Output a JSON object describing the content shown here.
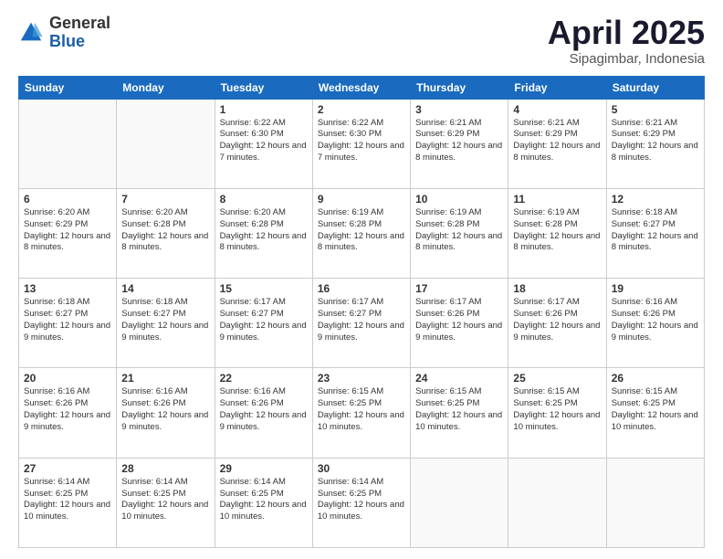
{
  "logo": {
    "general": "General",
    "blue": "Blue"
  },
  "title": "April 2025",
  "subtitle": "Sipagimbar, Indonesia",
  "days": [
    "Sunday",
    "Monday",
    "Tuesday",
    "Wednesday",
    "Thursday",
    "Friday",
    "Saturday"
  ],
  "weeks": [
    [
      {
        "day": "",
        "info": ""
      },
      {
        "day": "",
        "info": ""
      },
      {
        "day": "1",
        "info": "Sunrise: 6:22 AM\nSunset: 6:30 PM\nDaylight: 12 hours and 7 minutes."
      },
      {
        "day": "2",
        "info": "Sunrise: 6:22 AM\nSunset: 6:30 PM\nDaylight: 12 hours and 7 minutes."
      },
      {
        "day": "3",
        "info": "Sunrise: 6:21 AM\nSunset: 6:29 PM\nDaylight: 12 hours and 8 minutes."
      },
      {
        "day": "4",
        "info": "Sunrise: 6:21 AM\nSunset: 6:29 PM\nDaylight: 12 hours and 8 minutes."
      },
      {
        "day": "5",
        "info": "Sunrise: 6:21 AM\nSunset: 6:29 PM\nDaylight: 12 hours and 8 minutes."
      }
    ],
    [
      {
        "day": "6",
        "info": "Sunrise: 6:20 AM\nSunset: 6:29 PM\nDaylight: 12 hours and 8 minutes."
      },
      {
        "day": "7",
        "info": "Sunrise: 6:20 AM\nSunset: 6:28 PM\nDaylight: 12 hours and 8 minutes."
      },
      {
        "day": "8",
        "info": "Sunrise: 6:20 AM\nSunset: 6:28 PM\nDaylight: 12 hours and 8 minutes."
      },
      {
        "day": "9",
        "info": "Sunrise: 6:19 AM\nSunset: 6:28 PM\nDaylight: 12 hours and 8 minutes."
      },
      {
        "day": "10",
        "info": "Sunrise: 6:19 AM\nSunset: 6:28 PM\nDaylight: 12 hours and 8 minutes."
      },
      {
        "day": "11",
        "info": "Sunrise: 6:19 AM\nSunset: 6:28 PM\nDaylight: 12 hours and 8 minutes."
      },
      {
        "day": "12",
        "info": "Sunrise: 6:18 AM\nSunset: 6:27 PM\nDaylight: 12 hours and 8 minutes."
      }
    ],
    [
      {
        "day": "13",
        "info": "Sunrise: 6:18 AM\nSunset: 6:27 PM\nDaylight: 12 hours and 9 minutes."
      },
      {
        "day": "14",
        "info": "Sunrise: 6:18 AM\nSunset: 6:27 PM\nDaylight: 12 hours and 9 minutes."
      },
      {
        "day": "15",
        "info": "Sunrise: 6:17 AM\nSunset: 6:27 PM\nDaylight: 12 hours and 9 minutes."
      },
      {
        "day": "16",
        "info": "Sunrise: 6:17 AM\nSunset: 6:27 PM\nDaylight: 12 hours and 9 minutes."
      },
      {
        "day": "17",
        "info": "Sunrise: 6:17 AM\nSunset: 6:26 PM\nDaylight: 12 hours and 9 minutes."
      },
      {
        "day": "18",
        "info": "Sunrise: 6:17 AM\nSunset: 6:26 PM\nDaylight: 12 hours and 9 minutes."
      },
      {
        "day": "19",
        "info": "Sunrise: 6:16 AM\nSunset: 6:26 PM\nDaylight: 12 hours and 9 minutes."
      }
    ],
    [
      {
        "day": "20",
        "info": "Sunrise: 6:16 AM\nSunset: 6:26 PM\nDaylight: 12 hours and 9 minutes."
      },
      {
        "day": "21",
        "info": "Sunrise: 6:16 AM\nSunset: 6:26 PM\nDaylight: 12 hours and 9 minutes."
      },
      {
        "day": "22",
        "info": "Sunrise: 6:16 AM\nSunset: 6:26 PM\nDaylight: 12 hours and 9 minutes."
      },
      {
        "day": "23",
        "info": "Sunrise: 6:15 AM\nSunset: 6:25 PM\nDaylight: 12 hours and 10 minutes."
      },
      {
        "day": "24",
        "info": "Sunrise: 6:15 AM\nSunset: 6:25 PM\nDaylight: 12 hours and 10 minutes."
      },
      {
        "day": "25",
        "info": "Sunrise: 6:15 AM\nSunset: 6:25 PM\nDaylight: 12 hours and 10 minutes."
      },
      {
        "day": "26",
        "info": "Sunrise: 6:15 AM\nSunset: 6:25 PM\nDaylight: 12 hours and 10 minutes."
      }
    ],
    [
      {
        "day": "27",
        "info": "Sunrise: 6:14 AM\nSunset: 6:25 PM\nDaylight: 12 hours and 10 minutes."
      },
      {
        "day": "28",
        "info": "Sunrise: 6:14 AM\nSunset: 6:25 PM\nDaylight: 12 hours and 10 minutes."
      },
      {
        "day": "29",
        "info": "Sunrise: 6:14 AM\nSunset: 6:25 PM\nDaylight: 12 hours and 10 minutes."
      },
      {
        "day": "30",
        "info": "Sunrise: 6:14 AM\nSunset: 6:25 PM\nDaylight: 12 hours and 10 minutes."
      },
      {
        "day": "",
        "info": ""
      },
      {
        "day": "",
        "info": ""
      },
      {
        "day": "",
        "info": ""
      }
    ]
  ]
}
